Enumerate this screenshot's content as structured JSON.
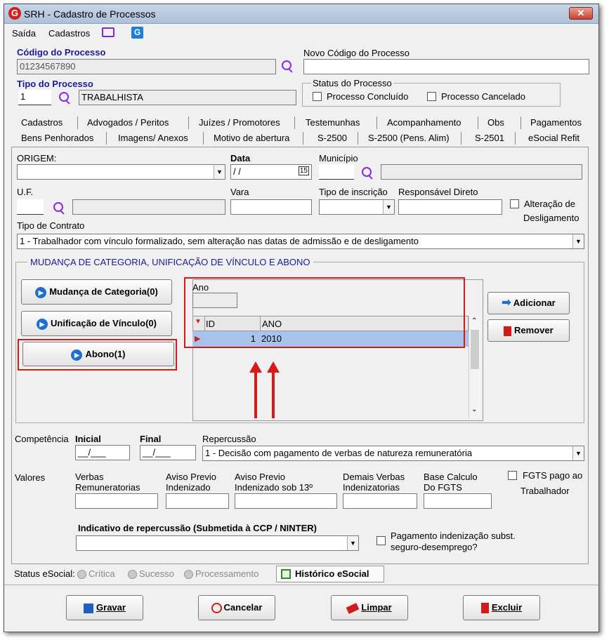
{
  "window": {
    "title": "SRH - Cadastro de Processos",
    "close": "✕"
  },
  "menu": {
    "saida": "Saída",
    "cadastros": "Cadastros"
  },
  "codigo": {
    "label": "Código do Processo",
    "value": "01234567890"
  },
  "novo": {
    "label": "Novo Código do Processo",
    "value": ""
  },
  "tipo": {
    "label": "Tipo do Processo",
    "code": "1",
    "desc": "TRABALHISTA"
  },
  "status": {
    "legend": "Status do Processo",
    "concluido": "Processo Concluído",
    "cancelado": "Processo Cancelado"
  },
  "tabs_row1": [
    "Cadastros",
    "Advogados / Peritos",
    "Juízes / Promotores",
    "Testemunhas",
    "Acompanhamento",
    "Obs",
    "Pagamentos"
  ],
  "tabs_row2": [
    "Bens Penhorados",
    "Imagens/ Anexos",
    "Motivo de abertura",
    "S-2500",
    "S-2500 (Pens. Alim)",
    "S-2501",
    "eSocial Refit"
  ],
  "form": {
    "origem": "ORIGEM:",
    "data": "Data",
    "data_value": "/ /",
    "municipio": "Município",
    "uf": "U.F.",
    "vara": "Vara",
    "tipo_insc": "Tipo de inscrição",
    "resp": "Responsável Direto",
    "alteracao": "Alteração de",
    "desligamento": "Desligamento",
    "tipo_contrato": "Tipo de Contrato",
    "tipo_contrato_value": "1 - Trabalhador com vínculo formalizado, sem alteração nas datas de admissão e de desligamento"
  },
  "group": {
    "legend": "MUDANÇA DE CATEGORIA, UNIFICAÇÃO DE VÍNCULO E ABONO",
    "mudanca": "Mudança de Categoria(0)",
    "unificacao": "Unificação de Vínculo(0)",
    "abono": "Abono(1)",
    "ano": "Ano",
    "col_id": "ID",
    "col_ano": "ANO",
    "row_id": "1",
    "row_ano": "2010",
    "adicionar": "Adicionar",
    "remover": "Remover"
  },
  "comp": {
    "competencia": "Competência",
    "inicial": "Inicial",
    "final": "Final",
    "ini_val": "__/___",
    "fin_val": "__/___",
    "repercussao": "Repercussão",
    "repercussao_value": "1 - Decisão com pagamento de verbas de natureza remuneratória"
  },
  "valores": {
    "label": "Valores",
    "v1a": "Verbas",
    "v1b": "Remuneratorias",
    "v2a": "Aviso Previo",
    "v2b": "Indenizado",
    "v3a": "Aviso Previo",
    "v3b": "Indenizado sob 13º",
    "v4a": "Demais Verbas",
    "v4b": "Indenizatorias",
    "v5a": "Base Calculo",
    "v5b": "Do FGTS",
    "fgts1": "FGTS pago ao",
    "fgts2": "Trabalhador"
  },
  "indicativo": {
    "label": "Indicativo de repercussão (Submetida à CCP / NINTER)",
    "pag1": "Pagamento indenização subst.",
    "pag2": "seguro-desemprego?"
  },
  "esocial": {
    "status": "Status eSocial:",
    "critica": "Crítica",
    "sucesso": "Sucesso",
    "processamento": "Processamento",
    "historico": "Histórico eSocial"
  },
  "buttons": {
    "gravar": "Gravar",
    "cancelar": "Cancelar",
    "limpar": "Limpar",
    "excluir": "Excluir"
  },
  "colors": {
    "accent_blue": "#1a1a9a",
    "highlight_red": "#d21c1c",
    "selected_row": "#a9c4ec"
  }
}
